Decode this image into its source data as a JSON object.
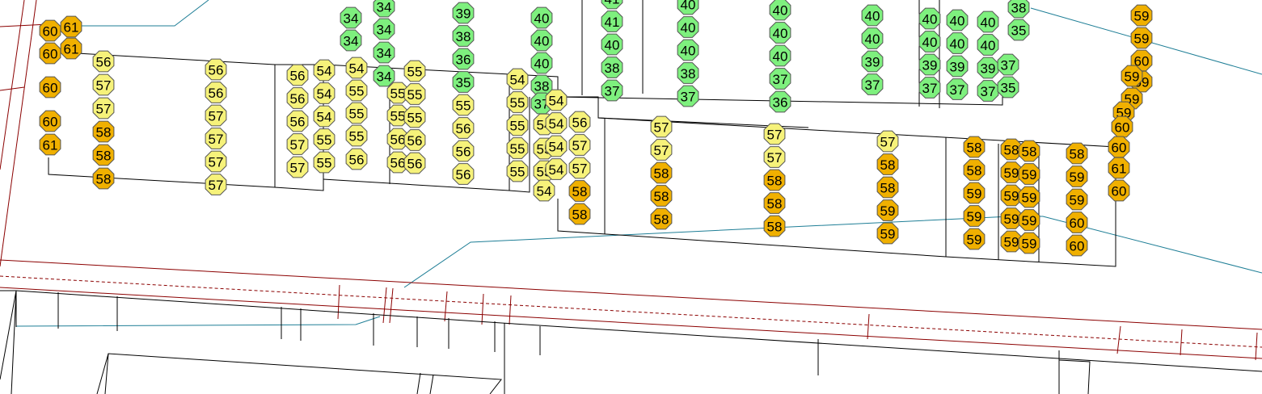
{
  "colors": {
    "band_low": "#7ef07e",
    "band_mid": "#f6f27a",
    "band_high": "#f0b000",
    "building_outline": "#000000",
    "water_line": "#1e7e96",
    "parcel_line": "#8b0000"
  },
  "marker_groups": [
    {
      "id": "g01",
      "values": [
        "60",
        "61",
        "60",
        "61",
        "60",
        "60",
        "61"
      ]
    },
    {
      "id": "g02",
      "values": [
        "56",
        "57",
        "57",
        "58",
        "58",
        "58"
      ]
    },
    {
      "id": "g03",
      "values": [
        "56",
        "56",
        "57",
        "57",
        "57",
        "57"
      ]
    },
    {
      "id": "g04",
      "values": [
        "56",
        "56",
        "56",
        "57",
        "57"
      ]
    },
    {
      "id": "g05",
      "values": [
        "54",
        "54",
        "54",
        "55",
        "55"
      ]
    },
    {
      "id": "g06",
      "values": [
        "34",
        "34",
        "54",
        "55",
        "55",
        "55",
        "56"
      ]
    },
    {
      "id": "g07",
      "values": [
        "34",
        "34",
        "34",
        "34",
        "55",
        "55",
        "56",
        "56"
      ]
    },
    {
      "id": "g08",
      "values": [
        "55",
        "55",
        "55",
        "56",
        "56"
      ]
    },
    {
      "id": "g09",
      "values": [
        "39",
        "38",
        "36",
        "35",
        "55",
        "56",
        "56",
        "56"
      ]
    },
    {
      "id": "g10",
      "values": [
        "54",
        "55",
        "55",
        "55",
        "55"
      ]
    },
    {
      "id": "g11",
      "values": [
        "40",
        "40",
        "40",
        "38",
        "37",
        "54",
        "55",
        "55",
        "54"
      ]
    },
    {
      "id": "g12",
      "values": [
        "54",
        "54",
        "54",
        "54"
      ]
    },
    {
      "id": "g13",
      "values": [
        "56",
        "57",
        "57",
        "58",
        "58"
      ]
    },
    {
      "id": "g14",
      "values": [
        "41",
        "41",
        "40",
        "38",
        "37"
      ]
    },
    {
      "id": "g15",
      "values": [
        "40",
        "40",
        "40",
        "38",
        "37"
      ]
    },
    {
      "id": "g16",
      "values": [
        "57",
        "57",
        "58",
        "58",
        "58"
      ]
    },
    {
      "id": "g17",
      "values": [
        "40",
        "40",
        "40",
        "37",
        "36"
      ]
    },
    {
      "id": "g18",
      "values": [
        "57",
        "57",
        "58",
        "58",
        "58"
      ]
    },
    {
      "id": "g19",
      "values": [
        "40",
        "40",
        "39",
        "37"
      ]
    },
    {
      "id": "g20",
      "values": [
        "57",
        "58",
        "58",
        "59",
        "59"
      ]
    },
    {
      "id": "g21",
      "values": [
        "40",
        "40",
        "39",
        "37"
      ]
    },
    {
      "id": "g22",
      "values": [
        "40",
        "40",
        "39",
        "37"
      ]
    },
    {
      "id": "g23",
      "values": [
        "40",
        "40",
        "39",
        "37"
      ]
    },
    {
      "id": "g24",
      "values": [
        "38",
        "35",
        "37",
        "35"
      ]
    },
    {
      "id": "g25",
      "values": [
        "58",
        "58",
        "59",
        "59",
        "59"
      ]
    },
    {
      "id": "g26",
      "values": [
        "58",
        "59",
        "59",
        "59",
        "59"
      ]
    },
    {
      "id": "g27",
      "values": [
        "58",
        "59",
        "59",
        "59",
        "59"
      ]
    },
    {
      "id": "g28",
      "values": [
        "58",
        "59",
        "59",
        "60",
        "60"
      ]
    },
    {
      "id": "g29",
      "values": [
        "59",
        "59",
        "60",
        "59",
        "59",
        "59",
        "59",
        "60",
        "60",
        "61",
        "60"
      ]
    }
  ]
}
